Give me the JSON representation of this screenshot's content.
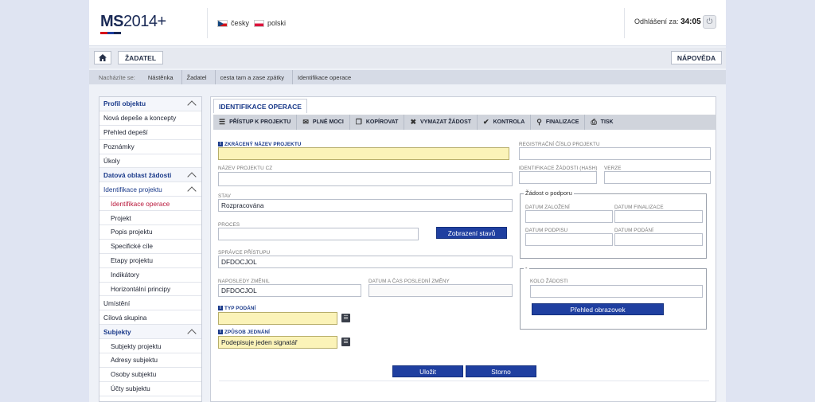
{
  "header": {
    "logo_main": "MS",
    "logo_year": "2014+",
    "logo_colors": [
      "#d7141a",
      "#1f3fa0",
      "#1a2a56"
    ],
    "languages": [
      {
        "label": "česky",
        "flag": "flag-cz-icon"
      },
      {
        "label": "polski",
        "flag": "flag-pl-icon"
      }
    ],
    "logout_label": "Odhlášení za:",
    "logout_time": "34:05",
    "power_icon": "power-icon"
  },
  "topnav": {
    "home_icon": "home-icon",
    "zadatel": "ŽADATEL",
    "napoveda": "NÁPOVĚDA"
  },
  "breadcrumb": {
    "label": "Nacházíte se:",
    "items": [
      "Nástěnka",
      "Žadatel",
      "cesta tam a zase zpátky",
      "Identifikace operace"
    ]
  },
  "leftnav": {
    "items": [
      {
        "label": "Profil objektu",
        "kind": "head"
      },
      {
        "label": "Nová depeše a koncepty",
        "kind": "item"
      },
      {
        "label": "Přehled depeší",
        "kind": "item"
      },
      {
        "label": "Poznámky",
        "kind": "item"
      },
      {
        "label": "Úkoly",
        "kind": "item"
      },
      {
        "label": "Datová oblast žádosti",
        "kind": "head"
      },
      {
        "label": "Identifikace projektu",
        "kind": "head2"
      },
      {
        "label": "Identifikace operace",
        "kind": "active"
      },
      {
        "label": "Projekt",
        "kind": "sub"
      },
      {
        "label": "Popis projektu",
        "kind": "sub"
      },
      {
        "label": "Specifické cíle",
        "kind": "sub"
      },
      {
        "label": "Etapy projektu",
        "kind": "sub"
      },
      {
        "label": "Indikátory",
        "kind": "sub"
      },
      {
        "label": "Horizontální principy",
        "kind": "sub"
      },
      {
        "label": "Umístění",
        "kind": "item"
      },
      {
        "label": "Cílová skupina",
        "kind": "item"
      },
      {
        "label": "Subjekty",
        "kind": "head"
      },
      {
        "label": "Subjekty projektu",
        "kind": "sub"
      },
      {
        "label": "Adresy subjektu",
        "kind": "sub"
      },
      {
        "label": "Osoby subjektu",
        "kind": "sub"
      },
      {
        "label": "Účty subjektu",
        "kind": "sub"
      }
    ]
  },
  "main": {
    "tab": "IDENTIFIKACE OPERACE",
    "toolbar": [
      {
        "label": "PŘÍSTUP K PROJEKTU",
        "icon": "users-icon"
      },
      {
        "label": "PLNÉ MOCI",
        "icon": "mail-icon"
      },
      {
        "label": "KOPÍROVAT",
        "icon": "copy-icon"
      },
      {
        "label": "VYMAZAT ŽÁDOST",
        "icon": "delete-icon"
      },
      {
        "label": "KONTROLA",
        "icon": "check-icon"
      },
      {
        "label": "FINALIZACE",
        "icon": "lock-icon"
      },
      {
        "label": "TISK",
        "icon": "print-icon"
      }
    ],
    "fields": {
      "short_name_label": "ZKRÁCENÝ NÁZEV PROJEKTU",
      "short_name_value": "",
      "name_cz_label": "NÁZEV PROJEKTU CZ",
      "name_cz_value": "",
      "state_label": "STAV",
      "state_value": "Rozpracována",
      "process_label": "PROCES",
      "process_value": "",
      "states_button": "Zobrazení stavů",
      "access_admin_label": "SPRÁVCE PŘÍSTUPU",
      "access_admin_value": "DFDOCJOL",
      "last_changed_label": "NAPOSLEDY ZMĚNIL",
      "last_changed_value": "DFDOCJOL",
      "last_change_date_label": "DATUM A ČAS POSLEDNÍ ZMĚNY",
      "last_change_date_value": "",
      "submit_type_label": "TYP PODÁNÍ",
      "submit_type_value": "",
      "acting_label": "ZPŮSOB JEDNÁNÍ",
      "acting_value": "Podepisuje jeden signatář",
      "reg_number_label": "REGISTRAČNÍ ČÍSLO PROJEKTU",
      "reg_number_value": "",
      "hash_label": "IDENTIFIKACE ŽÁDOSTI (HASH)",
      "hash_value": "",
      "version_label": "VERZE",
      "version_value": ""
    },
    "support": {
      "legend": "Žádost o podporu",
      "created_label": "DATUM ZALOŽENÍ",
      "created_value": "",
      "final_label": "DATUM FINALIZACE",
      "final_value": "",
      "signed_label": "DATUM PODPISU",
      "signed_value": "",
      "submitted_label": "DATUM PODÁNÍ",
      "submitted_value": ""
    },
    "round": {
      "legend": "-",
      "label": "KOLO ŽÁDOSTI",
      "value": "",
      "button": "Přehled obrazovek"
    },
    "actions": {
      "save": "Uložit",
      "cancel": "Storno"
    }
  }
}
